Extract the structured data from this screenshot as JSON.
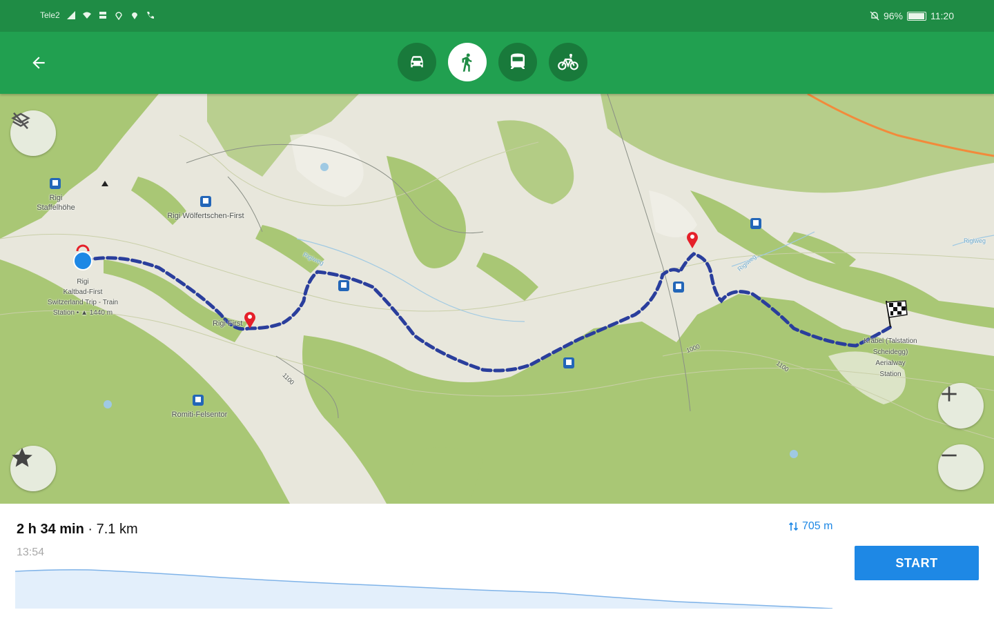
{
  "status_bar": {
    "carrier": "Tele2",
    "battery": "96%",
    "battery_level": 0.96,
    "time": "11:20"
  },
  "toolbar": {
    "back_icon": "arrow-left-icon",
    "modes": [
      {
        "name": "car",
        "icon": "car-icon",
        "active": false
      },
      {
        "name": "walk",
        "icon": "pedestrian-icon",
        "active": true
      },
      {
        "name": "transit",
        "icon": "train-icon",
        "active": false
      },
      {
        "name": "bike",
        "icon": "bicycle-icon",
        "active": false
      }
    ]
  },
  "map": {
    "labels": {
      "staffelhohe": "Rigi\nStaffelhöhe",
      "wolfertschen": "Rigi Wölfertschen-First",
      "kaltbad": "Rigi\nKaltbad-First\nSwitzerland Trip - Train\nStation • ▲ 1440 m",
      "rigi_first": "Rigi First",
      "romiti": "Romiti-Felsentor",
      "krabel": "Kräbel (Talstation\nScheidegg)\nAerialway\nStation",
      "contour_1": "1100",
      "contour_2": "1000",
      "contour_3": "1100",
      "path_1": "Rigiweg",
      "path_2": "Rigiweg",
      "path_3": "Rigiweg"
    },
    "controls": {
      "layers_icon": "layers-off-icon",
      "favorites_icon": "star-icon",
      "zoom_in_icon": "plus-icon",
      "zoom_out_icon": "minus-icon"
    },
    "colors": {
      "route": "#2a3e9c",
      "start_point": "#1e88e5",
      "pin": "#e5202a",
      "forest": "#a9c775",
      "meadow": "#e8e7dc"
    }
  },
  "route_summary": {
    "duration": "2 h 34 min",
    "separator": " · ",
    "distance": "7.1 km",
    "arrival": "13:54",
    "elevation": "705 m",
    "start_label": "START",
    "accent": "#1e88e5"
  }
}
